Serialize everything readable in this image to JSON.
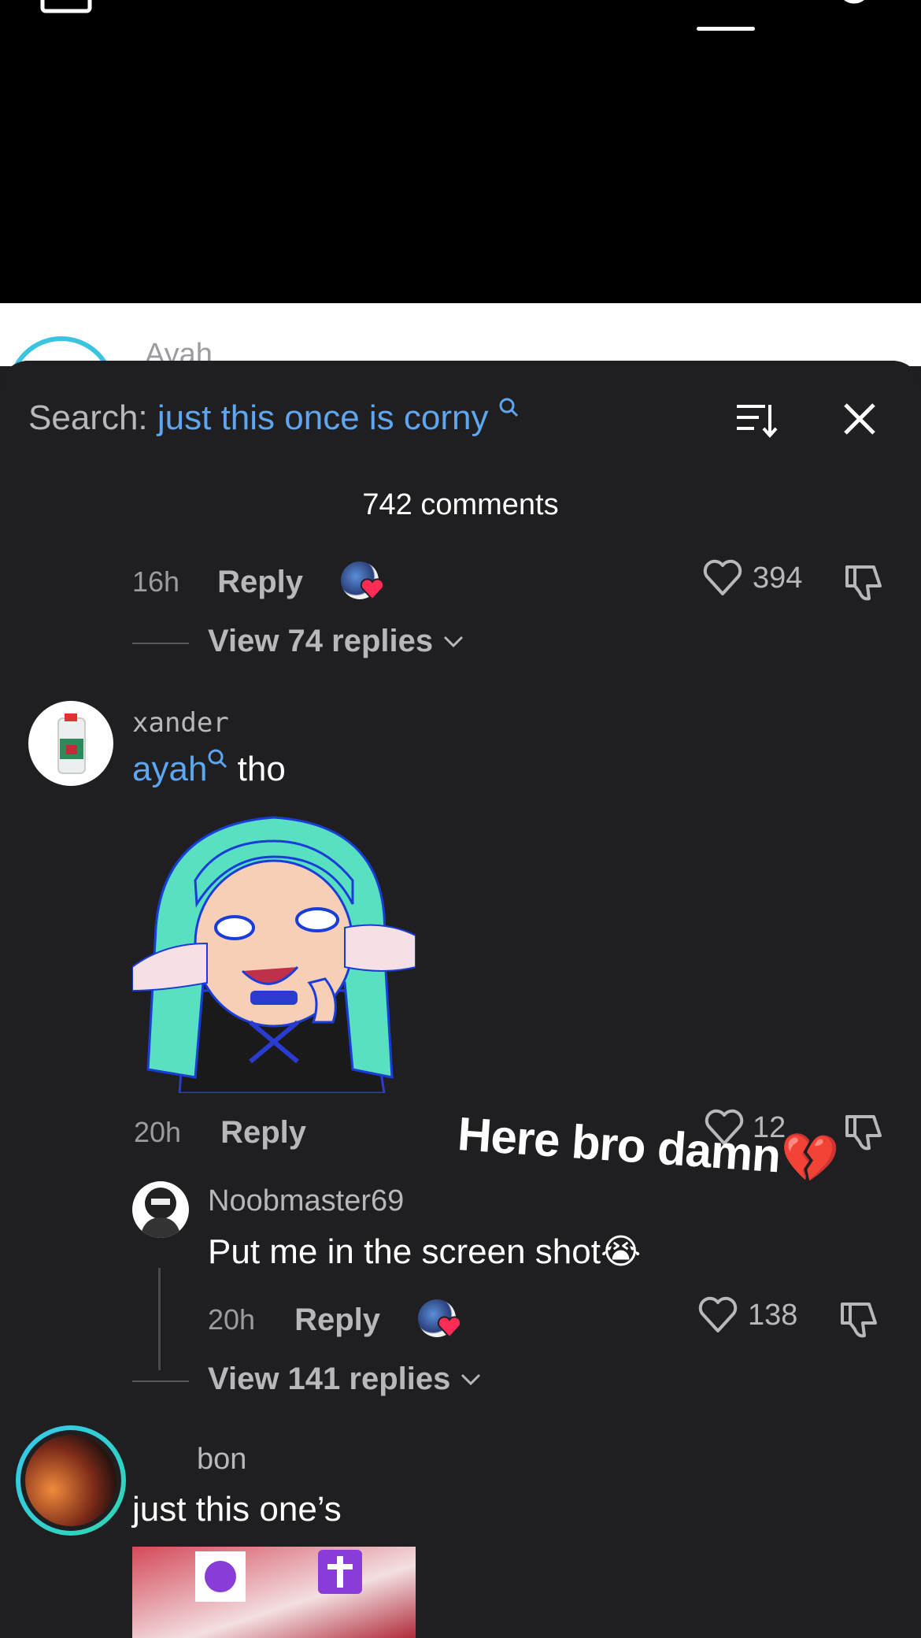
{
  "search": {
    "prefix": "Search:",
    "query": "just this once is corny"
  },
  "comment_count": "742 comments",
  "behind_name": "Ayah",
  "first_actions": {
    "time": "16h",
    "reply": "Reply",
    "likes": "394"
  },
  "first_view_replies": "View 74 replies",
  "xander": {
    "username": "xander",
    "mention": "ayah",
    "text": " tho",
    "time": "20h",
    "reply": "Reply",
    "likes": "12",
    "view_replies": "View 141 replies"
  },
  "overlay_text": "Here bro damn💔",
  "noob": {
    "username": "Noobmaster69",
    "text": "Put me in the screen shot😭",
    "time": "20h",
    "reply": "Reply",
    "likes": "138"
  },
  "bon": {
    "username": "bon",
    "text": "just this one’s"
  },
  "icons": {
    "sort": "sort-icon",
    "close": "close-icon",
    "heart": "heart-icon",
    "dislike": "dislike-icon",
    "chevron": "chevron-down-icon",
    "search_small": "search-mini-icon"
  },
  "colors": {
    "background": "#1f1f21",
    "accent": "#5ea6f0",
    "heart_badge": "#ff2d55"
  }
}
